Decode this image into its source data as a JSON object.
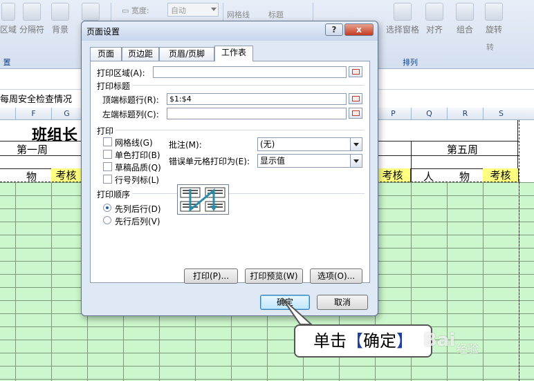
{
  "ribbon": {
    "buttons": [
      "区域",
      "分隔符",
      "背景"
    ],
    "width_label": "宽度:",
    "width_value": "自动",
    "gridlines_label": "网格线",
    "headings_label": "标题",
    "selection_pane": "选择窗格",
    "align": "对齐",
    "group": "组合",
    "rotate": "旋转",
    "rotate_dd": "转",
    "group_left": "置",
    "group_arrange": "排列"
  },
  "sheet": {
    "title_partial": "每周安全检查情况",
    "columns": [
      "F",
      "G",
      "P",
      "Q",
      "R",
      "S"
    ],
    "big_title": "班组长",
    "week1": "第一周",
    "week5": "第五周",
    "row3_cells": [
      "物",
      "考核",
      "考核",
      "人",
      "物",
      "考核"
    ]
  },
  "dialog": {
    "title": "页面设置",
    "help": "?",
    "close": "x",
    "tabs": [
      "页面",
      "页边距",
      "页眉/页脚",
      "工作表"
    ],
    "print_area_label": "打印区域(A):",
    "print_titles_label": "打印标题",
    "rows_repeat_label": "顶端标题行(R):",
    "rows_repeat_value": "$1:$4",
    "cols_repeat_label": "左端标题列(C):",
    "print_label": "打印",
    "gridlines": "网格线(G)",
    "bw": "单色打印(B)",
    "draft": "草稿品质(Q)",
    "rowcol": "行号列标(L)",
    "comments_label": "批注(M):",
    "comments_value": "(无)",
    "errors_label": "错误单元格打印为(E):",
    "errors_value": "显示值",
    "order_label": "打印顺序",
    "down_then_over": "先列后行(D)",
    "over_then_down": "先行后列(V)",
    "print_btn": "打印(P)...",
    "preview_btn": "打印预览(W)",
    "options_btn": "选项(O)...",
    "ok": "确定",
    "cancel": "取消"
  },
  "callout": {
    "prefix": "单击",
    "open": "【",
    "word": "确定",
    "close": "】"
  },
  "watermark": {
    "brand": "Bai",
    "sub": "经验"
  }
}
